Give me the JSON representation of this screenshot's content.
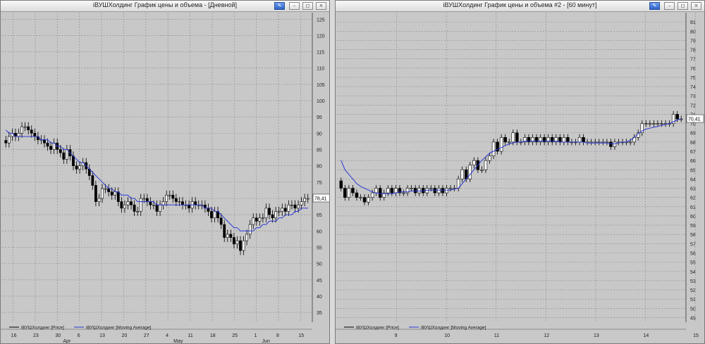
{
  "windows": [
    {
      "title": "iВУШХолдинг График цены и объема - [Дневной]",
      "price_label": "78,41",
      "buttons": {
        "pin": "✎",
        "minimize": "–",
        "maximize": "◻",
        "close": "×"
      },
      "legend": [
        {
          "label": "iВУШХолдинг [Price]",
          "color": "#000000"
        },
        {
          "label": "iВУШХолдинг [Moving Average]",
          "color": "#2d38d6"
        }
      ],
      "x_day_ticks": [
        "16",
        "23",
        "30",
        "6",
        "13",
        "20",
        "27",
        "4",
        "11",
        "18",
        "25",
        "1",
        "8",
        "15"
      ],
      "x_month_labels": [
        {
          "label": "Apr",
          "at": 2
        },
        {
          "label": "May",
          "at": 7
        },
        {
          "label": "Jun",
          "at": 11
        }
      ],
      "y_ticks": [
        35,
        40,
        45,
        50,
        55,
        60,
        65,
        70,
        75,
        80,
        85,
        90,
        95,
        100,
        105,
        110,
        115,
        120,
        125
      ],
      "y_range": [
        32,
        127
      ],
      "colors": {
        "up": "#ffffff",
        "down": "#000000",
        "ma": "#2d38d6",
        "bg": "#c8c8c8",
        "grid": "#8c8c8c"
      }
    },
    {
      "title": "iВУШХолдинг График цены и объема #2 - [60 минут]",
      "price_label": "70,41",
      "buttons": {
        "pin": "✎",
        "minimize": "–",
        "maximize": "◻",
        "close": "×"
      },
      "legend": [
        {
          "label": "iВУШХолдинг [Price]",
          "color": "#000000"
        },
        {
          "label": "iВУШХолдинг [Moving Average]",
          "color": "#2d38d6"
        }
      ],
      "x_day_ticks": [
        "9",
        "10",
        "11",
        "12",
        "13",
        "14",
        "15"
      ],
      "x_month_labels": [],
      "y_ticks": [
        49,
        50,
        51,
        52,
        53,
        54,
        55,
        56,
        57,
        58,
        59,
        60,
        61,
        62,
        63,
        64,
        65,
        66,
        67,
        68,
        69,
        70,
        71,
        72,
        73,
        74,
        75,
        76,
        77,
        78,
        79,
        80,
        81
      ],
      "y_range": [
        48.5,
        82
      ],
      "colors": {
        "up": "#ffffff",
        "down": "#000000",
        "ma": "#2d38d6",
        "bg": "#c8c8c8",
        "grid": "#8c8c8c"
      }
    }
  ],
  "chart_data": [
    {
      "type": "candlestick",
      "title": "iВУШХолдинг График цены и объема - [Дневной]",
      "ylim": [
        32,
        127
      ],
      "series": [
        {
          "name": "iВУШХолдинг [Price]",
          "close": [
            87,
            89,
            90,
            89,
            90,
            92,
            92,
            91,
            90,
            89,
            88,
            88,
            87,
            86,
            85,
            87,
            85,
            84,
            82,
            85,
            83,
            80,
            79,
            80,
            81,
            79,
            77,
            74,
            69,
            70,
            73,
            73,
            72,
            71,
            72,
            69,
            67,
            68,
            69,
            68,
            66,
            66,
            70,
            70,
            69,
            68,
            68,
            66,
            68,
            69,
            71,
            71,
            70,
            69,
            69,
            68,
            68,
            67,
            69,
            68,
            68,
            68,
            67,
            66,
            64,
            66,
            64,
            62,
            58,
            59,
            58,
            56,
            57,
            54,
            57,
            59,
            62,
            64,
            63,
            64,
            64,
            67,
            65,
            64,
            66,
            66,
            67,
            66,
            68,
            68,
            67,
            68,
            69,
            70,
            70
          ]
        },
        {
          "name": "iВУШХолдинг [Moving Average]",
          "values": [
            91,
            90,
            90,
            89,
            89,
            89,
            89,
            89,
            89,
            89,
            89,
            88,
            88,
            88,
            87,
            87,
            86,
            86,
            85,
            85,
            84,
            83,
            82,
            81,
            81,
            80,
            79,
            78,
            77,
            76,
            75,
            74,
            73,
            73,
            72,
            72,
            71,
            71,
            71,
            70,
            70,
            69,
            69,
            69,
            69,
            69,
            69,
            68,
            68,
            68,
            68,
            68,
            68,
            68,
            68,
            68,
            68,
            68,
            68,
            68,
            68,
            68,
            67,
            67,
            67,
            66,
            66,
            65,
            64,
            63,
            62,
            61,
            61,
            60,
            60,
            60,
            60,
            60,
            61,
            61,
            62,
            62,
            63,
            63,
            63,
            64,
            64,
            65,
            65,
            65,
            66,
            66,
            67,
            67,
            67
          ]
        }
      ]
    },
    {
      "type": "candlestick",
      "title": "iВУШХолдинг График цены и объема #2 - [60 минут]",
      "ylim": [
        48.5,
        82
      ],
      "series": [
        {
          "name": "iВУШХолдинг [Price]",
          "close": [
            63,
            62,
            63,
            62.5,
            62,
            62,
            61.5,
            62,
            62.5,
            63,
            62,
            62.5,
            63,
            62.5,
            63,
            62.5,
            62.5,
            63,
            63,
            62.5,
            63,
            62.5,
            63,
            63,
            62.5,
            63,
            62.5,
            63,
            63,
            63,
            64,
            65,
            64,
            65.5,
            66,
            65,
            65,
            66,
            66.5,
            68,
            67,
            68.5,
            68,
            68,
            69,
            68,
            68,
            68.5,
            68,
            68.5,
            68,
            68.5,
            68,
            68.5,
            68,
            68.5,
            68,
            68.5,
            68,
            68,
            68,
            68.5,
            68,
            68,
            68,
            68,
            68,
            68,
            68,
            67.5,
            68,
            68,
            68,
            68,
            68,
            68.5,
            69,
            70,
            70,
            70,
            70,
            70,
            70,
            70,
            70,
            71,
            70.5,
            70.5
          ]
        },
        {
          "name": "iВУШХолдинг [Moving Average]",
          "values": [
            66,
            65,
            64.5,
            64,
            63.5,
            63.2,
            63,
            62.8,
            62.6,
            62.5,
            62.4,
            62.4,
            62.4,
            62.4,
            62.5,
            62.6,
            62.6,
            62.6,
            62.7,
            62.7,
            62.7,
            62.7,
            62.8,
            62.8,
            62.8,
            62.8,
            62.8,
            62.8,
            62.8,
            62.9,
            63,
            63.5,
            64,
            64.5,
            65,
            65.5,
            66,
            66.4,
            66.8,
            67,
            67.2,
            67.4,
            67.6,
            67.8,
            67.9,
            68,
            68,
            68.1,
            68.1,
            68.1,
            68.1,
            68.1,
            68.1,
            68.1,
            68.1,
            68.1,
            68,
            68,
            68,
            68,
            68,
            68,
            68,
            67.9,
            67.9,
            67.9,
            67.9,
            67.9,
            67.9,
            67.8,
            67.8,
            67.9,
            68,
            68,
            68.2,
            68.5,
            68.9,
            69.2,
            69.4,
            69.5,
            69.6,
            69.7,
            69.8,
            69.9,
            70,
            70.2,
            70.4,
            70.5
          ]
        }
      ]
    }
  ]
}
